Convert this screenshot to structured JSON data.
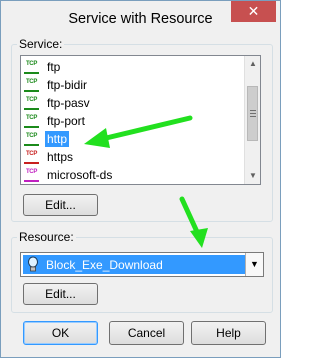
{
  "window": {
    "title": "Service with Resource",
    "close_glyph": "✕"
  },
  "service": {
    "label": "Service:",
    "items": [
      {
        "icon_text": "TCP",
        "label": "ftp"
      },
      {
        "icon_text": "TCP",
        "label": "ftp-bidir"
      },
      {
        "icon_text": "TCP",
        "label": "ftp-pasv"
      },
      {
        "icon_text": "TCP",
        "label": "ftp-port"
      },
      {
        "icon_text": "TCP",
        "label": "http"
      },
      {
        "icon_text": "TCP",
        "label": "https"
      },
      {
        "icon_text": "TCP",
        "label": "microsoft-ds"
      }
    ],
    "selected": "http",
    "edit_label": "Edit..."
  },
  "resource": {
    "label": "Resource:",
    "selected": "Block_Exe_Download",
    "edit_label": "Edit..."
  },
  "footer": {
    "ok_label": "OK",
    "cancel_label": "Cancel",
    "help_label": "Help"
  },
  "colors": {
    "selection": "#3399ff",
    "arrow": "#22e01f",
    "close": "#c75050"
  }
}
